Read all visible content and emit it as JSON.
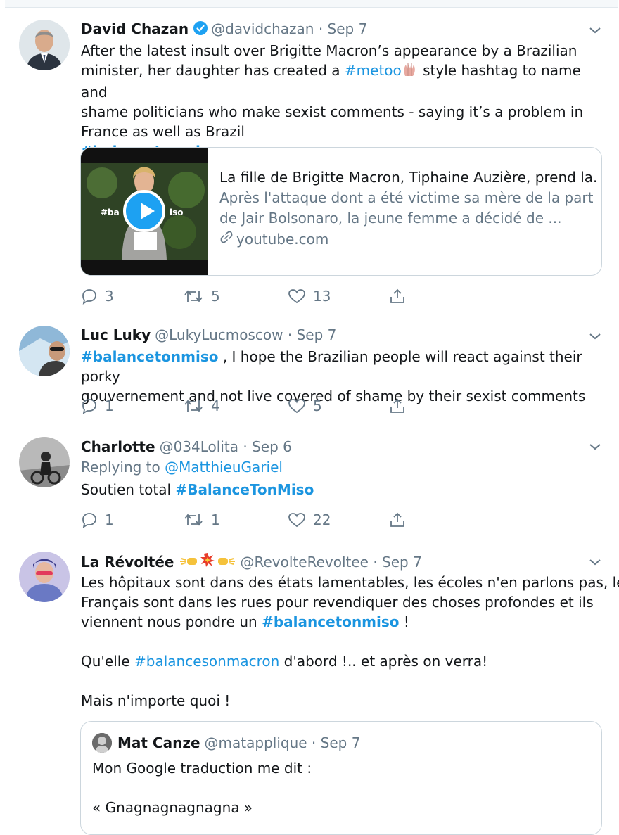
{
  "tweets": [
    {
      "name": "David Chazan",
      "handle": "@davidchazan",
      "date": "Sep 7",
      "text_1": "After the latest insult over Brigitte Macron’s appearance by a Brazilian",
      "text_2a": "minister, her daughter has created a ",
      "hashtag_inline": "#metoo",
      "text_2b": " style hashtag to name and",
      "text_3": "shame politicians who make sexist comments - saying it’s a problem in",
      "text_4": "France as well as Brazil",
      "hashtag_line": "#balancetonmiso",
      "card": {
        "title": "La fille de Brigitte Macron, Tiphaine Auzière, prend la...",
        "desc_1": "Après l'attaque dont a été victime sa mère de la part",
        "desc_2": "de Jair Bolsonaro, la jeune femme a décidé de ...",
        "domain": "youtube.com"
      },
      "replies": "3",
      "retweets": "5",
      "likes": "13"
    },
    {
      "name": "Luc Luky",
      "handle": "@LukyLucmoscow",
      "date": "Sep 7",
      "hashtag": "#balancetonmiso",
      "text_1": " , I hope the Brazilian people will react against their porky",
      "text_2": "gouvernement and not live covered of shame by their sexist comments",
      "replies": "1",
      "retweets": "4",
      "likes": "5"
    },
    {
      "name": "Charlotte",
      "handle": "@034Lolita",
      "date": "Sep 6",
      "replying_prefix": "Replying to ",
      "replying_to": "@MatthieuGariel",
      "text": "Soutien total ",
      "hashtag": "#BalanceTonMiso",
      "replies": "1",
      "retweets": "1",
      "likes": "22"
    },
    {
      "name": "La Révoltée",
      "handle": "@RevolteRevoltee",
      "date": "Sep 7",
      "text_1": "Les hôpitaux sont dans des états lamentables, les écoles n'en parlons pas, les",
      "text_2": "Français sont dans les rues pour revendiquer des choses profondes et ils",
      "text_3a": "viennent nous pondre un ",
      "text_3_hashtag": "#balancetonmiso",
      "text_3b": " !",
      "text_4a": "Qu'elle ",
      "text_4_hashtag": "#balancesonmacron",
      "text_4b": " d'abord !.. et après on verra!",
      "text_5": "Mais n'importe quoi !",
      "quote": {
        "name": "Mat Canze",
        "handle": "@matapplique",
        "date": "Sep 7",
        "text_1": "Mon Google traduction me dit :",
        "text_2": "« Gnagnagnagnagna »"
      }
    }
  ],
  "colors": {
    "link": "#1b95e0",
    "muted": "#657786",
    "verified": "#1da1f2",
    "border": "#e1e8ed"
  },
  "icons": [
    "verified-badge-icon",
    "chevron-down-icon",
    "reply-icon",
    "retweet-icon",
    "like-icon",
    "share-icon",
    "link-icon",
    "play-icon"
  ]
}
